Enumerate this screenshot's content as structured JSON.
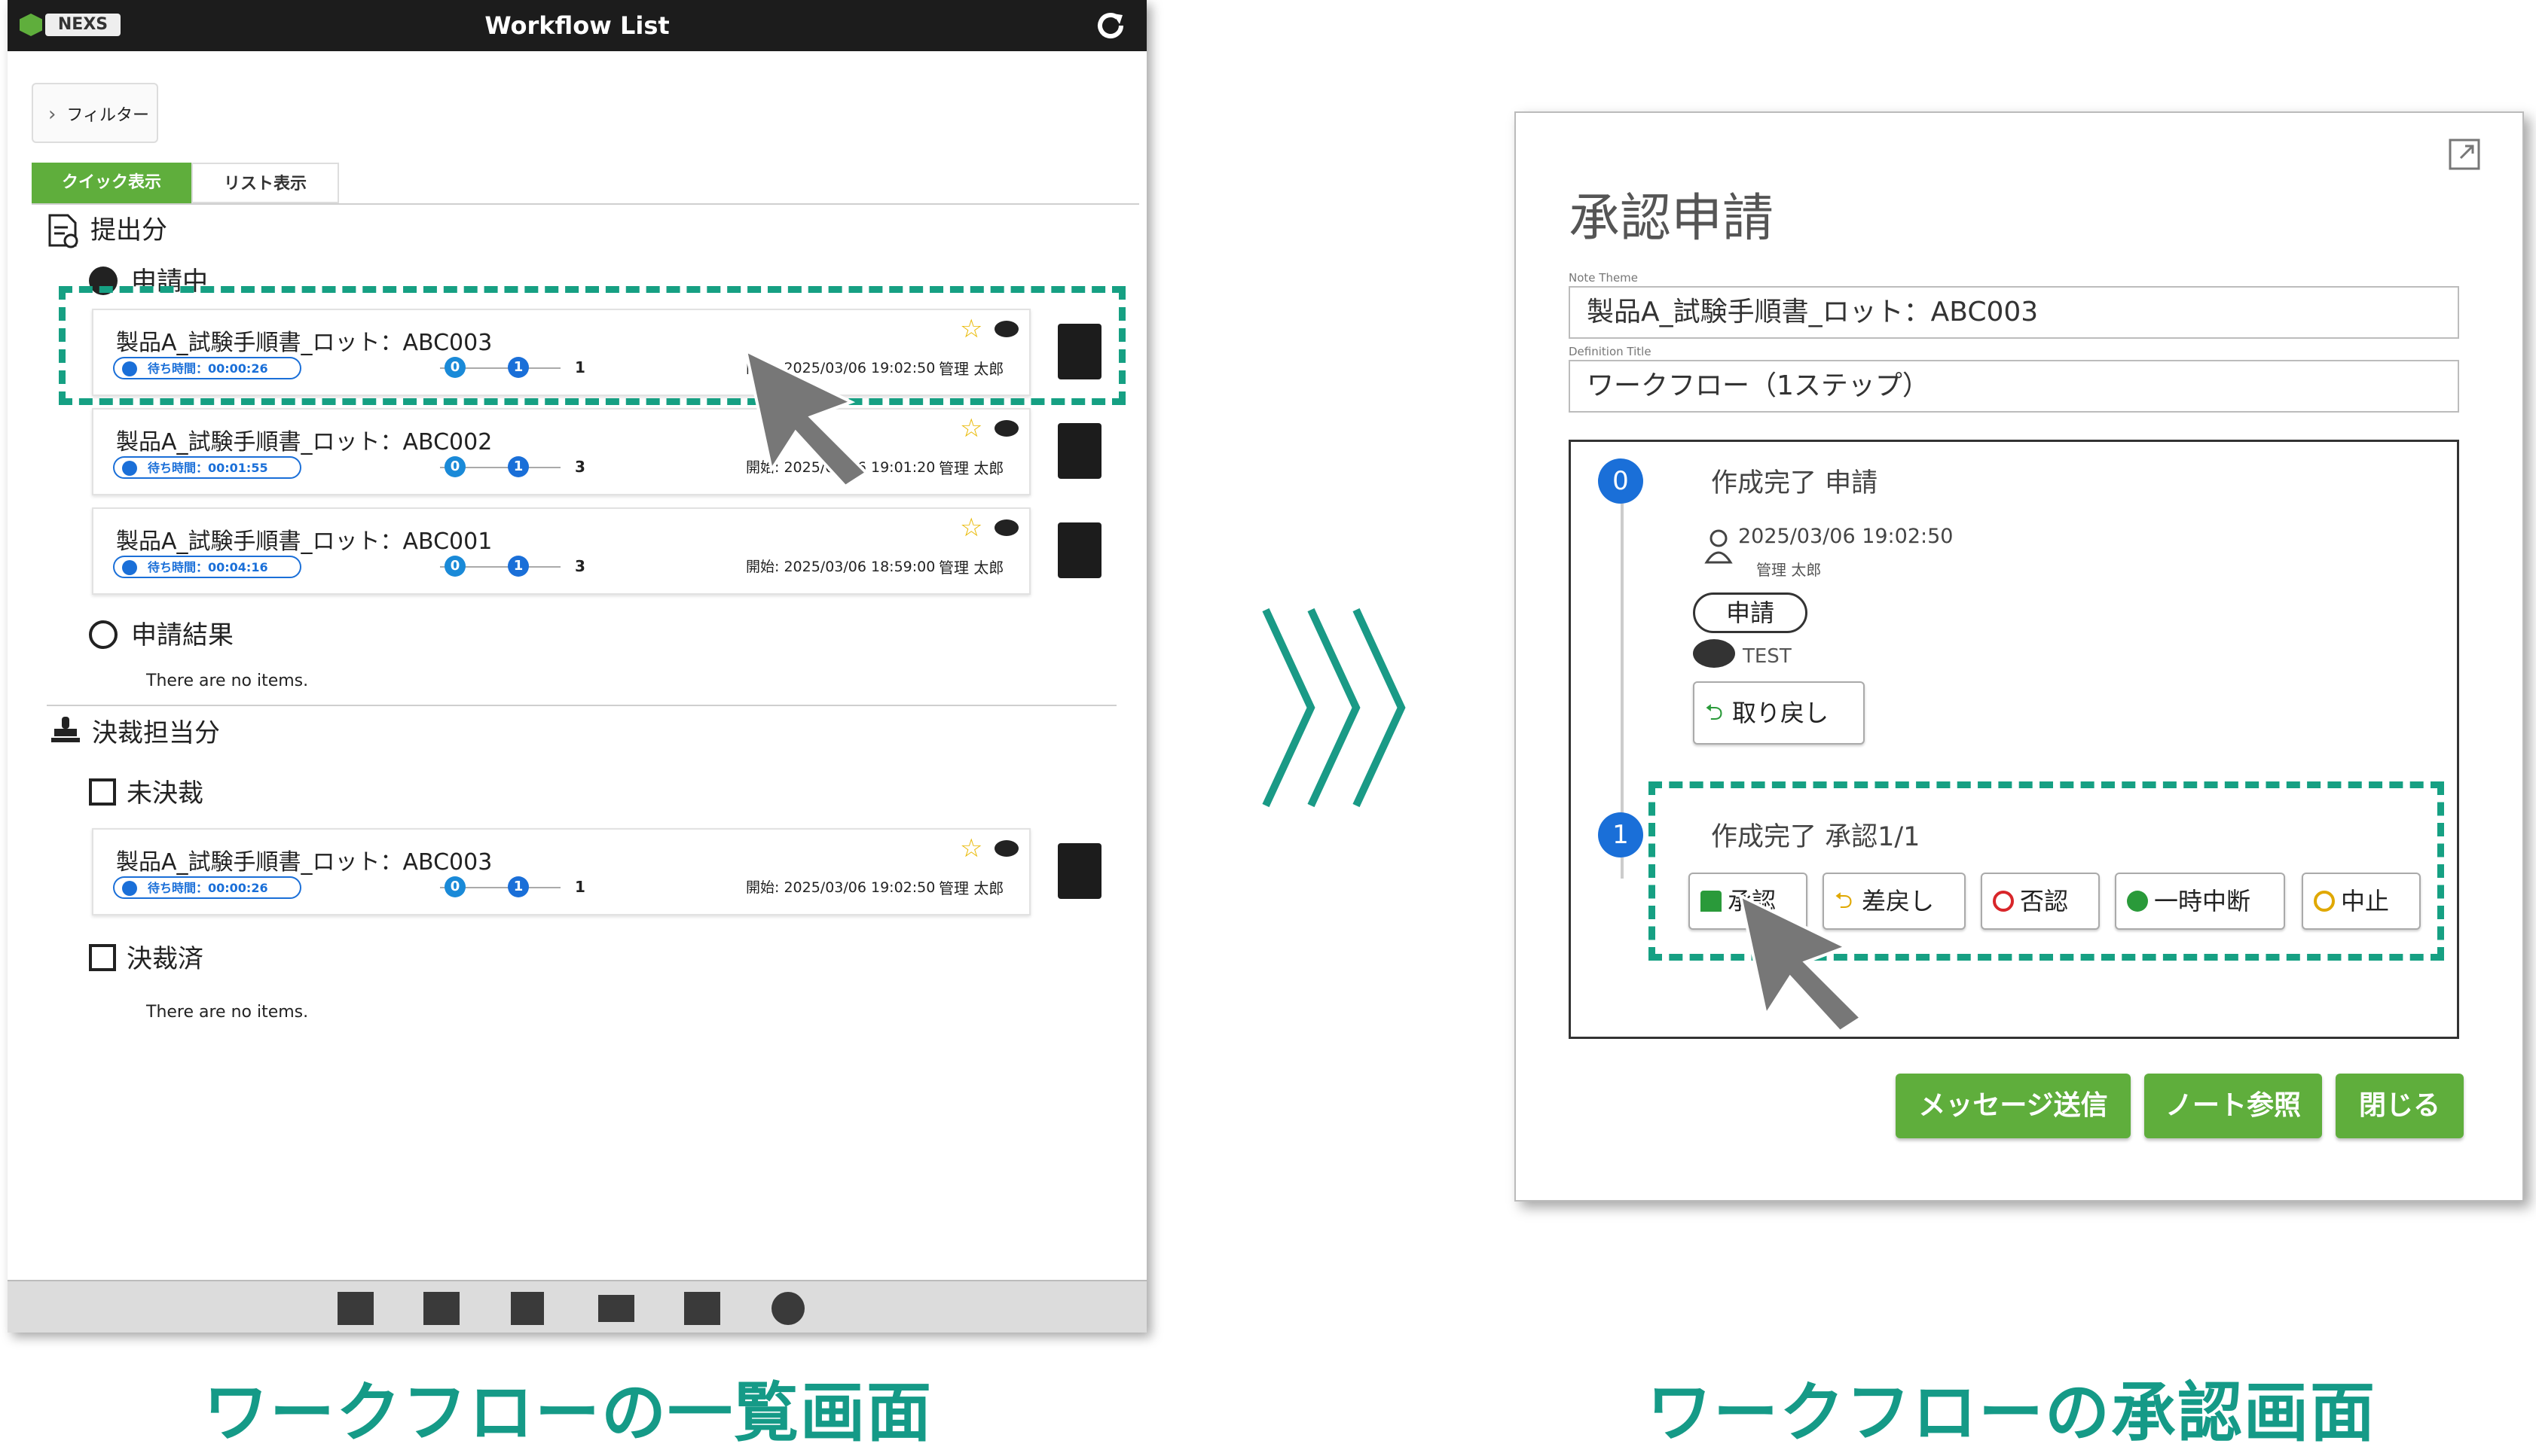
{
  "colors": {
    "brand_green": "#5fae3c",
    "highlight_teal": "#16a083",
    "step_blue": "#1a6fd8",
    "titlebar": "#1c1c1c"
  },
  "left": {
    "logo_text": "NEXS",
    "window_title": "Workflow List",
    "filter_label": "フィルター",
    "tabs": [
      "クイック表示",
      "リスト表示"
    ],
    "submitted": {
      "heading": "提出分",
      "in_progress_label": "申請中",
      "items": [
        {
          "title": "製品A_試験手順書_ロット：ABC003",
          "wait": "待ち時間：00:00:26",
          "step0": "0",
          "step1": "1",
          "last": "1",
          "date": "開始: 2025/03/06 19:02:50",
          "user": "管理 太郎"
        },
        {
          "title": "製品A_試験手順書_ロット：ABC002",
          "wait": "待ち時間：00:01:55",
          "step0": "0",
          "step1": "1",
          "last": "3",
          "date": "開始: 2025/03/06 19:01:20",
          "user": "管理 太郎"
        },
        {
          "title": "製品A_試験手順書_ロット：ABC001",
          "wait": "待ち時間：00:04:16",
          "step0": "0",
          "step1": "1",
          "last": "3",
          "date": "開始: 2025/03/06 18:59:00",
          "user": "管理 太郎"
        }
      ],
      "results_label": "申請結果",
      "no_items": "There are no items."
    },
    "approval": {
      "heading": "決裁担当分",
      "pending_label": "未決裁",
      "items": [
        {
          "title": "製品A_試験手順書_ロット：ABC003",
          "wait": "待ち時間：00:00:26",
          "step0": "0",
          "step1": "1",
          "last": "1",
          "date": "開始: 2025/03/06 19:02:50",
          "user": "管理 太郎"
        }
      ],
      "done_label": "決裁済",
      "no_items": "There are no items."
    },
    "bottom_icons": [
      "list-icon",
      "dashboard-icon",
      "note-icon",
      "mail-icon",
      "workflow-icon",
      "gear-icon"
    ],
    "caption": "ワークフローの一覧画面"
  },
  "right": {
    "title": "承認申請",
    "note_theme_label": "Note Theme",
    "note_theme_value": "製品A_試験手順書_ロット：ABC003",
    "definition_label": "Definition Title",
    "definition_value": "ワークフロー（1ステップ）",
    "step0": {
      "number": "0",
      "title": "作成完了 申請",
      "datetime": "2025/03/06 19:02:50",
      "user": "管理 太郎",
      "tag": "申請",
      "comment": "TEST",
      "revert_button": "取り戻し"
    },
    "step1": {
      "number": "1",
      "title": "作成完了 承認1/1",
      "buttons": [
        "承認",
        "差戻し",
        "否認",
        "一時中断",
        "中止"
      ]
    },
    "footer_buttons": [
      "メッセージ送信",
      "ノート参照",
      "閉じる"
    ],
    "caption": "ワークフローの承認画面"
  }
}
